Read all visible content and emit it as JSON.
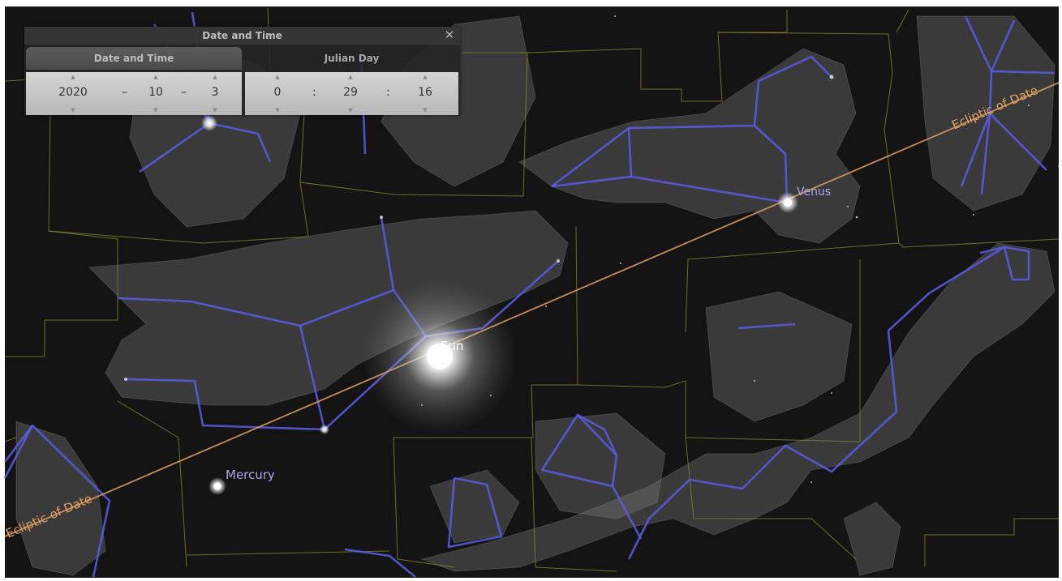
{
  "dialog": {
    "title": "Date and Time",
    "close_glyph": "✕",
    "tabs": [
      "Date and Time",
      "Julian Day"
    ],
    "date": {
      "year": "2020",
      "month": "10",
      "day": "3"
    },
    "time": {
      "hour": "0",
      "minute": "29",
      "second": "16"
    },
    "date_separator": "–",
    "time_separator": ":",
    "arrow_up": "▲",
    "arrow_down": "▼"
  },
  "sky": {
    "labels": {
      "venus": "Venus",
      "sun": "Sun",
      "mercury": "Mercury",
      "ecliptic_right": "Ecliptic of Date",
      "ecliptic_left": "Ecliptic of Date"
    },
    "colors": {
      "background": "#121212",
      "constellation_lines": "#5c5ce6",
      "boundaries": "#8c8c2e",
      "ecliptic": "#e0a060",
      "planet_label": "#a8a8ee"
    }
  }
}
